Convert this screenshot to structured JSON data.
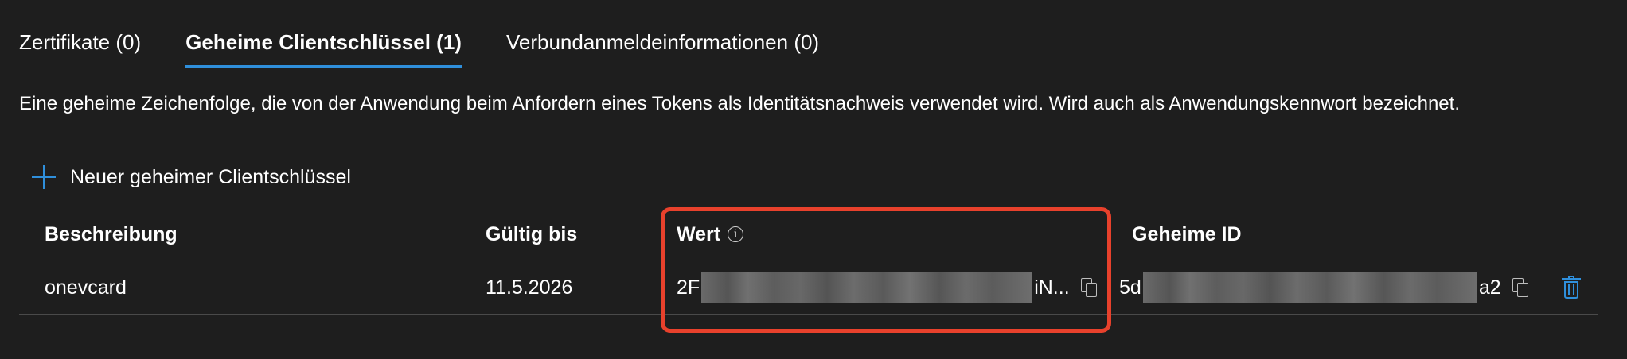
{
  "tabs": [
    {
      "label": "Zertifikate (0)",
      "active": false
    },
    {
      "label": "Geheime Clientschlüssel (1)",
      "active": true
    },
    {
      "label": "Verbundanmeldeinformationen (0)",
      "active": false
    }
  ],
  "description": "Eine geheime Zeichenfolge, die von der Anwendung beim Anfordern eines Tokens als Identitätsnachweis verwendet wird. Wird auch als Anwendungskennwort bezeichnet.",
  "new_secret_label": "Neuer geheimer Clientschlüssel",
  "table": {
    "columns": {
      "description": "Beschreibung",
      "expires": "Gültig bis",
      "value": "Wert",
      "secret_id": "Geheime ID"
    },
    "rows": [
      {
        "description": "onevcard",
        "expires": "11.5.2026",
        "value_prefix": "2F",
        "value_suffix": "iN...",
        "secret_id_prefix": "5d",
        "secret_id_suffix": "a2"
      }
    ]
  },
  "icons": {
    "info": "info-circle-icon",
    "add": "plus-icon",
    "copy": "copy-icon",
    "delete": "trash-icon"
  },
  "colors": {
    "background": "#1e1e1e",
    "accent": "#2f8fdb",
    "highlight": "#e8412c",
    "divider": "#4a4a4a"
  }
}
